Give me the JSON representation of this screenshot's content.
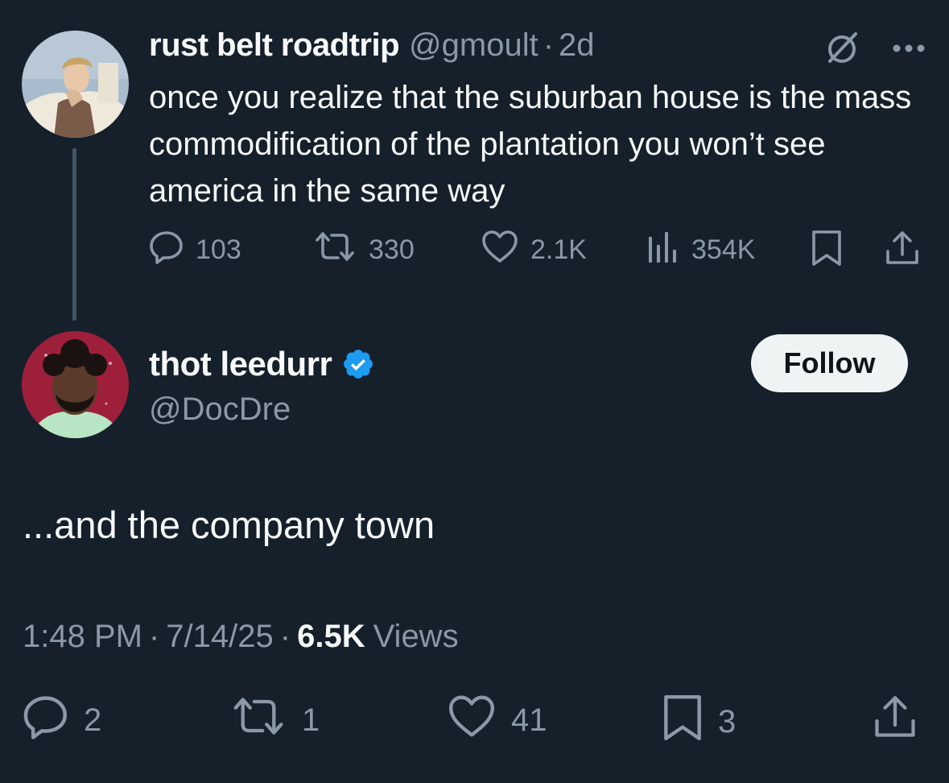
{
  "original_tweet": {
    "display_name": "rust belt roadtrip",
    "handle": "@gmoult",
    "separator": "·",
    "time_ago": "2d",
    "text": "once you realize that the suburban house is the mass commodification of the plantation you won’t see america in the same way",
    "stats": {
      "replies": "103",
      "reposts": "330",
      "likes": "2.1K",
      "views": "354K"
    }
  },
  "reply_tweet": {
    "display_name": "thot leedurr",
    "handle": "@DocDre",
    "verified": true,
    "follow_label": "Follow",
    "text": "...and the company town",
    "timestamp_time": "1:48 PM",
    "timestamp_date": "7/14/25",
    "separator": "·",
    "views_count": "6.5K",
    "views_label": "Views",
    "stats": {
      "replies": "2",
      "reposts": "1",
      "likes": "41",
      "bookmarks": "3"
    }
  },
  "colors": {
    "background": "#15202b",
    "text_primary": "#f7f9f9",
    "text_secondary": "#8b98a5",
    "verified_blue": "#1d9bf0",
    "thread_line": "#425466"
  },
  "icons": {
    "grok": "grok-icon",
    "more": "more-icon",
    "reply": "reply-icon",
    "repost": "repost-icon",
    "like": "like-icon",
    "views": "views-icon",
    "bookmark": "bookmark-icon",
    "share": "share-icon",
    "verified": "verified-badge-icon"
  }
}
